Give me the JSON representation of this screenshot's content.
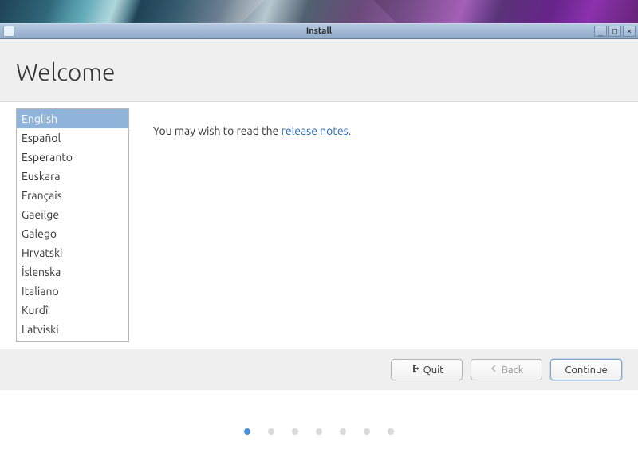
{
  "window": {
    "title": "Install"
  },
  "heading": "Welcome",
  "languages": [
    "English",
    "Español",
    "Esperanto",
    "Euskara",
    "Français",
    "Gaeilge",
    "Galego",
    "Hrvatski",
    "Íslenska",
    "Italiano",
    "Kurdî",
    "Latviski"
  ],
  "selected_language_index": 0,
  "body": {
    "prefix": "You may wish to read the ",
    "link": "release notes",
    "suffix": "."
  },
  "buttons": {
    "quit": "Quit",
    "back": "Back",
    "continue": "Continue"
  },
  "pager": {
    "total": 7,
    "active": 0
  }
}
